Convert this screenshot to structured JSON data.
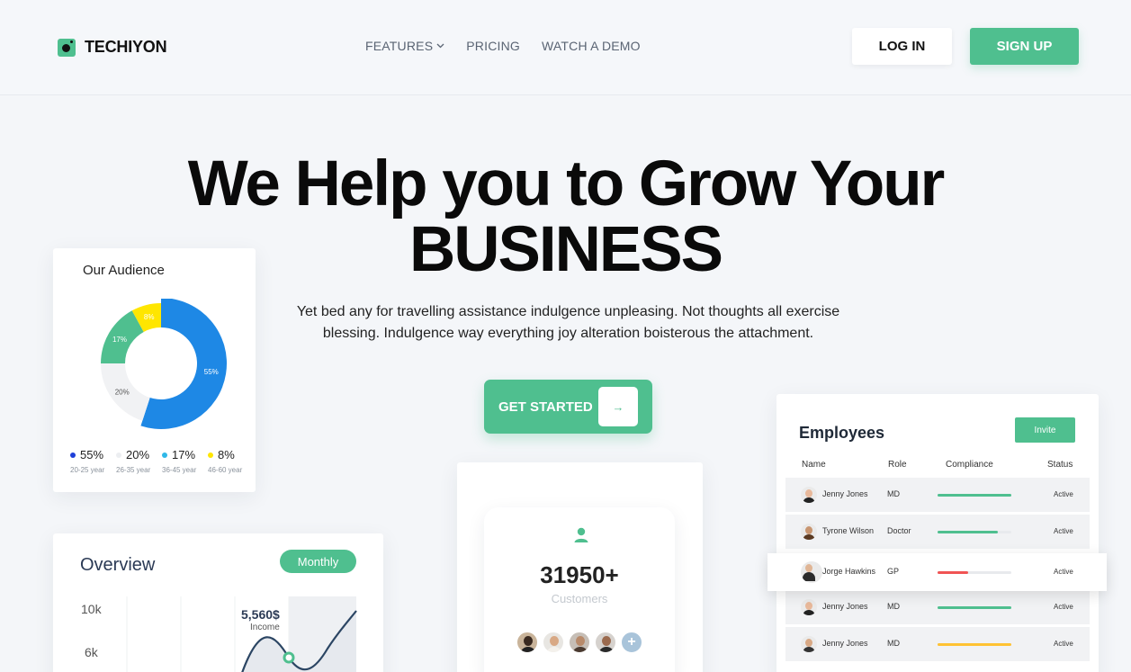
{
  "brand": {
    "name": "TECHIYON",
    "accent": "#4fbf8f"
  },
  "nav": {
    "items": [
      {
        "label": "FEATURES",
        "has_dropdown": true
      },
      {
        "label": "PRICING"
      },
      {
        "label": "WATCH A DEMO"
      }
    ],
    "login_label": "LOG IN",
    "signup_label": "SIGN UP"
  },
  "hero": {
    "title_line1": "We Help you to Grow Your",
    "title_line2": "BUSINESS",
    "subtitle_line1": "Yet bed any for travelling assistance indulgence unpleasing. Not thoughts all exercise",
    "subtitle_line2": "blessing. Indulgence way everything joy alteration boisterous the attachment.",
    "cta_label": "GET STARTED",
    "cta_icon": "arrow-right-icon"
  },
  "audience": {
    "title": "Our Audience",
    "chart_data": {
      "type": "pie",
      "categories": [
        "20-25 year",
        "26-35 year",
        "36-45 year",
        "46-60 year"
      ],
      "values": [
        55,
        20,
        17,
        8
      ],
      "labels": [
        "55%",
        "20%",
        "17%",
        "8%"
      ],
      "colors": [
        "#1e88e5",
        "#f1f2f4",
        "#4fbf8f",
        "#ffe600"
      ],
      "legend_dot_colors": [
        "#1e3fd8",
        "#eceef1",
        "#2fb8e8",
        "#ffe600"
      ]
    },
    "legend": [
      {
        "value": "55%",
        "range": "20-25 year",
        "color": "#1e3fd8"
      },
      {
        "value": "20%",
        "range": "26-35 year",
        "color": "#eceef1"
      },
      {
        "value": "17%",
        "range": "36-45 year",
        "color": "#2fb8e8"
      },
      {
        "value": "8%",
        "range": "46-60 year",
        "color": "#ffe600"
      }
    ]
  },
  "overview": {
    "title": "Overview",
    "period_button": "Monthly",
    "y_ticks": [
      "10k",
      "6k"
    ],
    "highlight_value": "5,560$",
    "highlight_label": "Income"
  },
  "customers": {
    "count": "31950+",
    "label": "Customers",
    "icon": "user-icon",
    "more_icon": "plus-icon"
  },
  "employees": {
    "title": "Employees",
    "invite_label": "Invite",
    "columns": [
      "Name",
      "Role",
      "Compliance",
      "Status"
    ],
    "rows": [
      {
        "name": "Jenny Jones",
        "role": "MD",
        "compliance": 1.0,
        "color": "#4fbf8f",
        "status": "Active"
      },
      {
        "name": "Tyrone Wilson",
        "role": "Doctor",
        "compliance": 0.82,
        "color": "#4fbf8f",
        "status": "Active"
      },
      {
        "name": "Jorge Hawkins",
        "role": "GP",
        "compliance": 0.42,
        "color": "#f05454",
        "status": "Active"
      },
      {
        "name": "Jenny Jones",
        "role": "MD",
        "compliance": 1.0,
        "color": "#4fbf8f",
        "status": "Active"
      },
      {
        "name": "Jenny Jones",
        "role": "MD",
        "compliance": 1.0,
        "color": "#ffc233",
        "status": "Active"
      }
    ]
  }
}
